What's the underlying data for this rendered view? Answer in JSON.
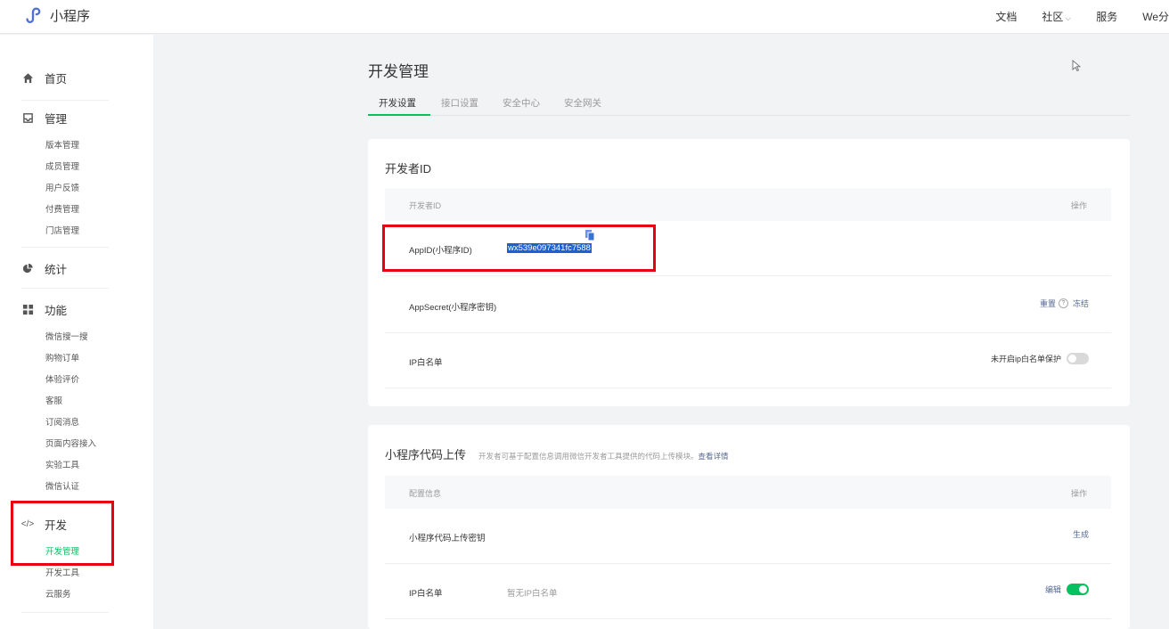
{
  "topbar": {
    "logo_text": "小程序",
    "nav": [
      "文档",
      "社区",
      "服务",
      "We分"
    ],
    "community_chevron": "⌵"
  },
  "sidebar": {
    "groups": [
      {
        "title": "首页",
        "icon": "home-icon",
        "items": []
      },
      {
        "title": "管理",
        "icon": "inbox-icon",
        "items": [
          "版本管理",
          "成员管理",
          "用户反馈",
          "付费管理",
          "门店管理"
        ]
      },
      {
        "title": "统计",
        "icon": "pie-chart-icon",
        "items": []
      },
      {
        "title": "功能",
        "icon": "grid-icon",
        "items": [
          "微信搜一搜",
          "购物订单",
          "体验评价",
          "客服",
          "订阅消息",
          "页面内容接入",
          "实验工具",
          "微信认证"
        ]
      },
      {
        "title": "开发",
        "icon": "code-icon",
        "items": [
          "开发管理",
          "开发工具",
          "云服务"
        ],
        "active_item": "开发管理"
      }
    ],
    "code_glyph": "</>"
  },
  "main": {
    "title": "开发管理",
    "tabs": [
      "开发设置",
      "接口设置",
      "安全中心",
      "安全网关"
    ],
    "active_tab": "开发设置"
  },
  "developer_id": {
    "title": "开发者ID",
    "header": {
      "left": "开发者ID",
      "right": "操作"
    },
    "appid": {
      "label": "AppID(小程序ID)",
      "value": "wx539e097341fc7588"
    },
    "appsecret": {
      "label": "AppSecret(小程序密钥)",
      "reset": "重置",
      "help": "?",
      "freeze": "冻结"
    },
    "ip_whitelist": {
      "label": "IP白名单",
      "status": "未开启ip白名单保护",
      "enabled": false
    }
  },
  "code_upload": {
    "title": "小程序代码上传",
    "subtitle": "开发者可基于配置信息调用微信开发者工具提供的代码上传模块。",
    "detail_link": "查看详情",
    "header": {
      "left": "配置信息",
      "right": "操作"
    },
    "upload_key": {
      "label": "小程序代码上传密钥",
      "action": "生成"
    },
    "ip_whitelist": {
      "label": "IP白名单",
      "value": "暂无IP白名单",
      "action": "编辑",
      "enabled": true
    }
  },
  "colors": {
    "accent": "#07c160",
    "highlight": "#e60012",
    "link": "#576b95",
    "selection": "#1f5fcf"
  }
}
